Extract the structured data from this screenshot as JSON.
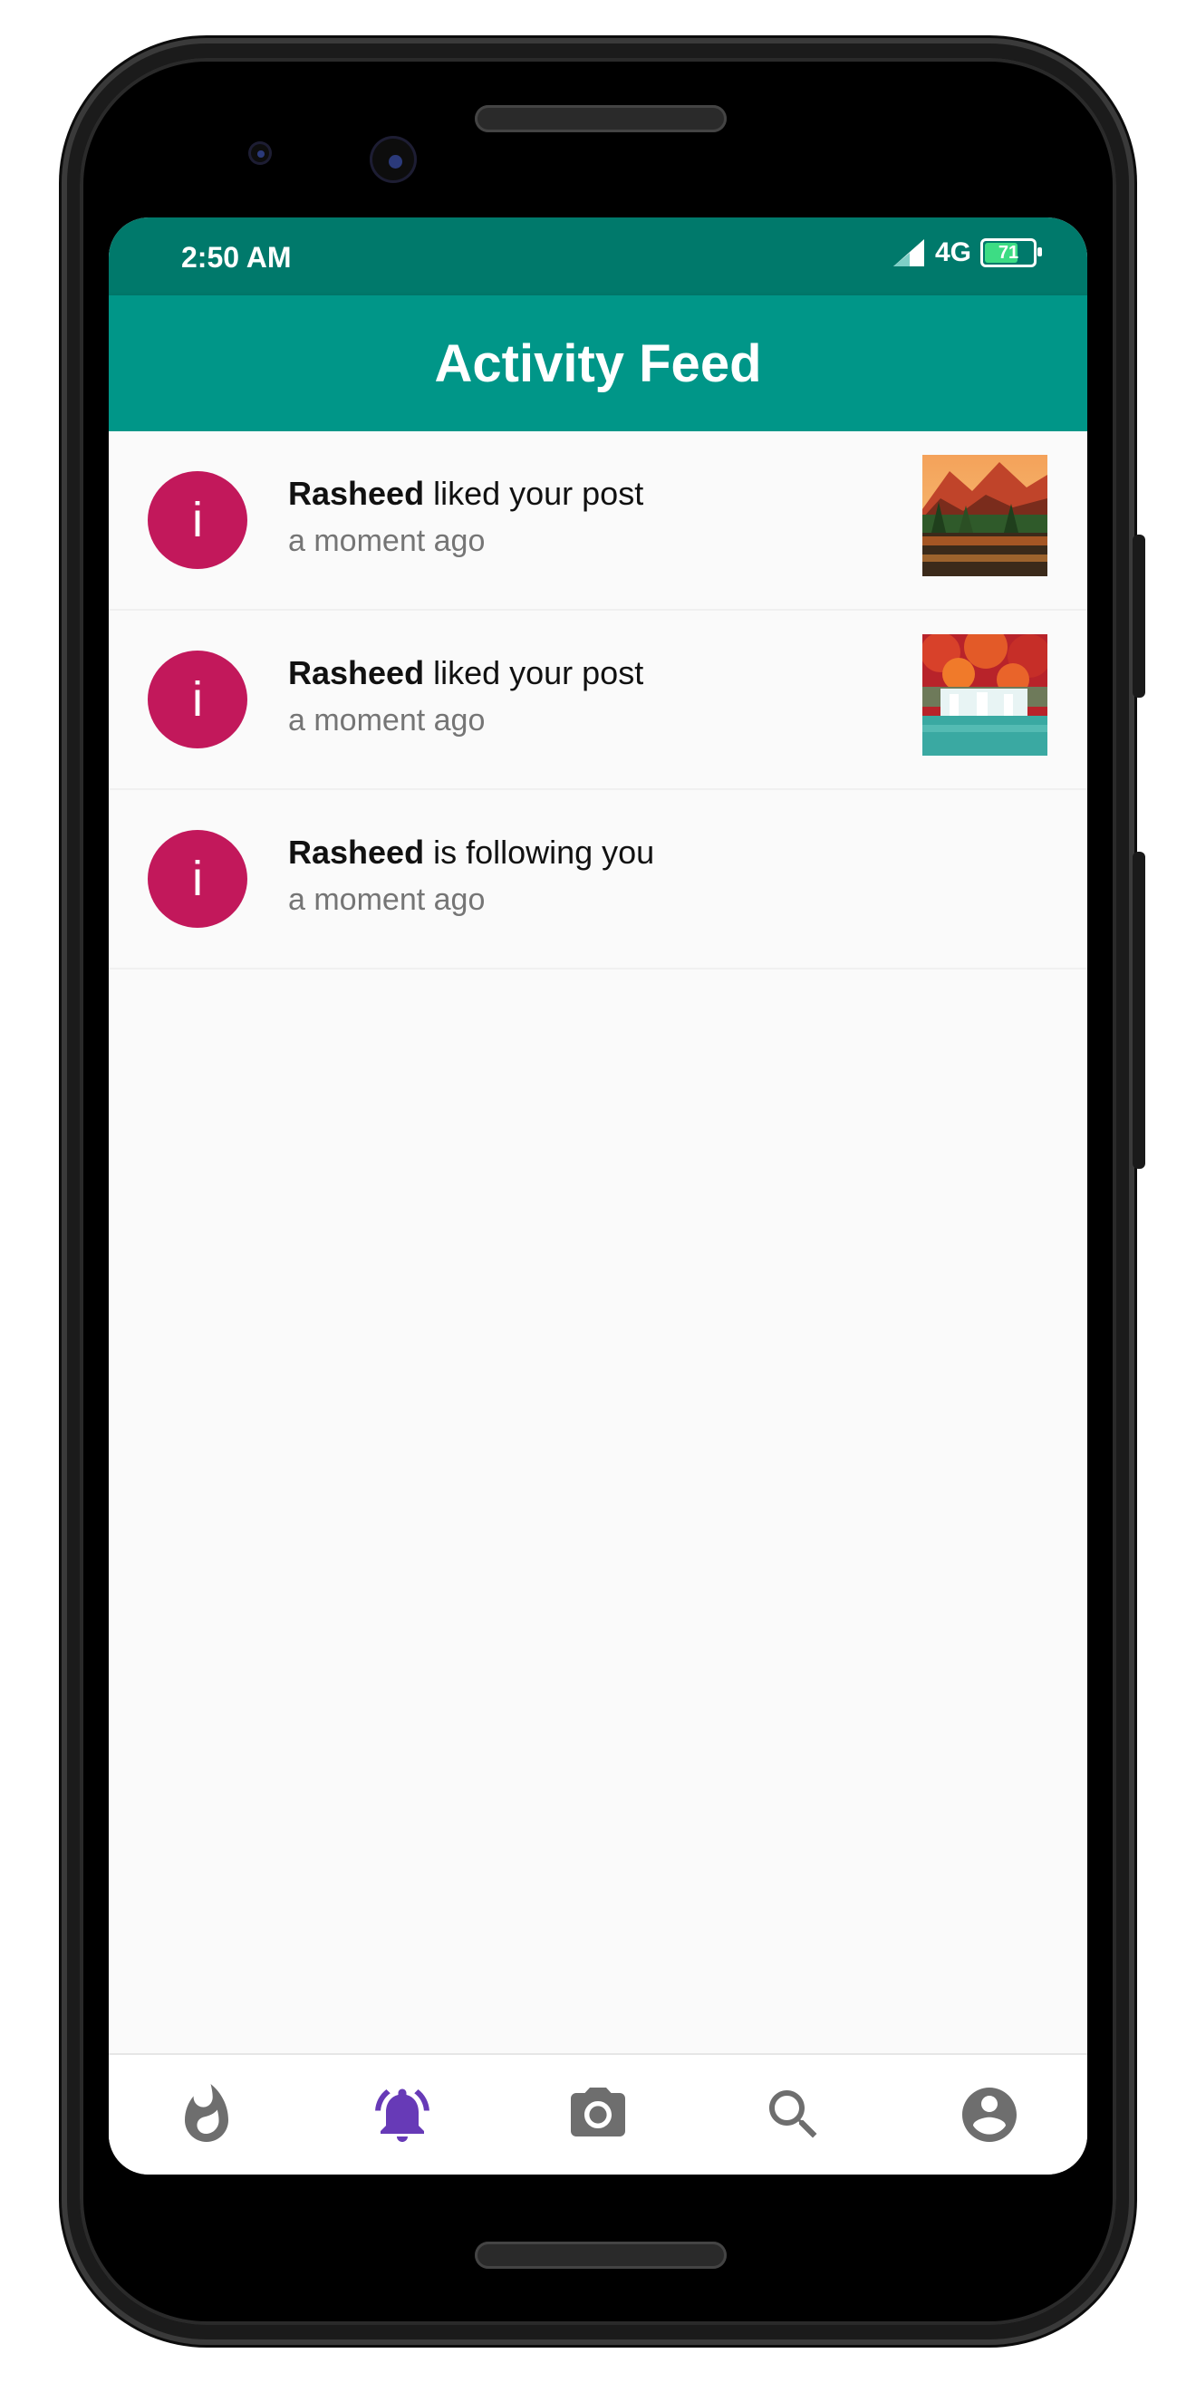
{
  "status_bar": {
    "time": "2:50 AM",
    "network": "4G",
    "battery": "71"
  },
  "app_bar": {
    "title": "Activity Feed"
  },
  "feed": [
    {
      "avatar_letter": "i",
      "user": "Rasheed",
      "action": " liked your post",
      "time": "a moment ago",
      "has_thumbnail": true,
      "thumbnail": "autumn-mountain-lake"
    },
    {
      "avatar_letter": "i",
      "user": "Rasheed",
      "action": " liked your post",
      "time": "a moment ago",
      "has_thumbnail": true,
      "thumbnail": "autumn-waterfall"
    },
    {
      "avatar_letter": "i",
      "user": "Rasheed",
      "action": " is following you",
      "time": "a moment ago",
      "has_thumbnail": false
    }
  ],
  "bottom_nav": [
    {
      "icon": "fire-icon",
      "active": false
    },
    {
      "icon": "bell-icon",
      "active": true
    },
    {
      "icon": "camera-icon",
      "active": false
    },
    {
      "icon": "search-icon",
      "active": false
    },
    {
      "icon": "account-icon",
      "active": false
    }
  ],
  "colors": {
    "primary": "#009688",
    "primary_dark": "#00796b",
    "avatar": "#c2185b",
    "nav_active": "#673ab7",
    "nav_inactive": "#6e6e6e"
  }
}
